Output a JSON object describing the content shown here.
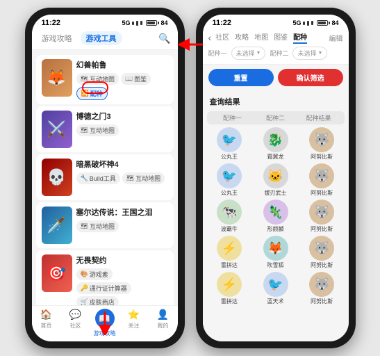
{
  "left_phone": {
    "status": {
      "time": "11:22",
      "signal": "5G",
      "battery": "84"
    },
    "header": {
      "tab_guide": "游戏攻略",
      "tab_tools": "游戏工具",
      "tab_tools_active": true,
      "search_label": "搜索"
    },
    "games": [
      {
        "title": "幻兽帕鲁",
        "color": "#8B4513",
        "emoji": "🦊",
        "bg": "#c8a080",
        "tools": [
          {
            "label": "互动地图",
            "highlight": false
          },
          {
            "label": "图鉴",
            "highlight": false
          },
          {
            "label": "配种",
            "highlight": true
          }
        ]
      },
      {
        "title": "博德之门3",
        "color": "#4a3060",
        "emoji": "⚔️",
        "bg": "#8060a0",
        "tools": [
          {
            "label": "互动地图",
            "highlight": false
          }
        ]
      },
      {
        "title": "暗黑破坏神4",
        "color": "#8b0000",
        "emoji": "💀",
        "bg": "#c03030",
        "tools": [
          {
            "label": "Build工具",
            "highlight": false
          },
          {
            "label": "互动地图",
            "highlight": false
          }
        ]
      },
      {
        "title": "塞尔达传说：王国之泪",
        "color": "#2060a0",
        "emoji": "🗡️",
        "bg": "#60a0d0",
        "tools": [
          {
            "label": "互动地图",
            "highlight": false
          }
        ]
      },
      {
        "title": "无畏契约",
        "color": "#c03030",
        "emoji": "🎯",
        "bg": "#e05050",
        "tools": [
          {
            "label": "游戏素",
            "highlight": false
          },
          {
            "label": "通行证计算器",
            "highlight": false
          },
          {
            "label": "皮肤商店",
            "highlight": false
          }
        ]
      }
    ],
    "bottom_nav": [
      {
        "label": "首页",
        "icon": "🏠"
      },
      {
        "label": "社区",
        "icon": "💬"
      },
      {
        "label": "游戏攻略",
        "icon": "📖",
        "active": true
      },
      {
        "label": "关注",
        "icon": "⭐"
      },
      {
        "label": "我的",
        "icon": "👤"
      }
    ]
  },
  "right_phone": {
    "status": {
      "time": "11:22",
      "signal": "5G",
      "battery": "84"
    },
    "nav_tabs": [
      "社区",
      "攻略",
      "地图",
      "图鉴",
      "配种"
    ],
    "active_nav": "配种",
    "edit_label": "编辑",
    "filter": {
      "label1": "配种一",
      "label2": "配种二",
      "label3": "配种结果",
      "placeholder": "未选择"
    },
    "buttons": {
      "reset": "重置",
      "confirm": "确认筛选"
    },
    "results_title": "查询结果",
    "results_cols": [
      "配种一",
      "配种二",
      "配种结果"
    ],
    "results": [
      {
        "p1": "公丸王",
        "p1_emoji": "🐦",
        "p1_bg": "av-blue",
        "p2": "霜翼龙",
        "p2_emoji": "🐉",
        "p2_bg": "av-gray",
        "p3": "阿努比斯",
        "p3_emoji": "🐺",
        "p3_bg": "av-brown"
      },
      {
        "p1": "公丸王",
        "p1_emoji": "🐦",
        "p1_bg": "av-blue",
        "p2": "拔刃武士",
        "p2_emoji": "🐱",
        "p2_bg": "av-gray",
        "p3": "阿努比斯",
        "p3_emoji": "🐺",
        "p3_bg": "av-brown"
      },
      {
        "p1": "波霸牛",
        "p1_emoji": "🐄",
        "p1_bg": "av-green",
        "p2": "形颜麟",
        "p2_emoji": "🦎",
        "p2_bg": "av-purple",
        "p3": "阿努比斯",
        "p3_emoji": "🐺",
        "p3_bg": "av-brown"
      },
      {
        "p1": "雷拼达",
        "p1_emoji": "⚡",
        "p1_bg": "av-yellow",
        "p2": "吹雪狐",
        "p2_emoji": "🦊",
        "p2_bg": "av-teal",
        "p3": "阿努比斯",
        "p3_emoji": "🐺",
        "p3_bg": "av-brown"
      },
      {
        "p1": "雷拼达",
        "p1_emoji": "⚡",
        "p1_bg": "av-yellow",
        "p2": "蓝天术",
        "p2_emoji": "🐦",
        "p2_bg": "av-blue",
        "p3": "阿努比斯",
        "p3_emoji": "🐺",
        "p3_bg": "av-brown"
      }
    ]
  },
  "arrows": {
    "right_arrow_label": "→",
    "down_arrow_label": "↓"
  }
}
